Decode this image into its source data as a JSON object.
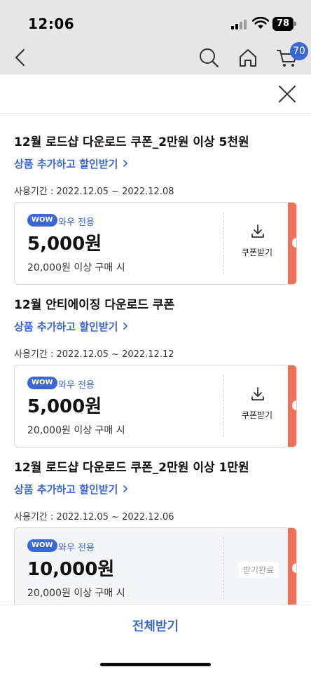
{
  "status_bar": {
    "time": "12:06",
    "battery": "78"
  },
  "nav": {
    "cart_badge": "70"
  },
  "coupons": [
    {
      "title": "12월 로드샵 다운로드 쿠폰_2만원 이상 5천원",
      "link": "상품 추가하고 할인받기",
      "period": "사용기간 : 2022.12.05 ~ 2022.12.08",
      "badge": "WOW",
      "badge_label": "와우 전용",
      "amount": "5,000원",
      "condition": "20,000원 이상 구매 시",
      "action": "쿠폰받기"
    },
    {
      "title": "12월 안티에이징 다운로드 쿠폰",
      "link": "상품 추가하고 할인받기",
      "period": "사용기간 : 2022.12.05 ~ 2022.12.12",
      "badge": "WOW",
      "badge_label": "와우 전용",
      "amount": "5,000원",
      "condition": "20,000원 이상 구매 시",
      "action": "쿠폰받기"
    },
    {
      "title": "12월 로드샵 다운로드 쿠폰_2만원 이상 1만원",
      "link": "상품 추가하고 할인받기",
      "period": "사용기간 : 2022.12.05 ~ 2022.12.06",
      "badge": "WOW",
      "badge_label": "와우 전용",
      "amount": "10,000원",
      "condition": "20,000원 이상 구매 시",
      "action": "받기완료"
    }
  ],
  "bottom": {
    "all_button": "전체받기"
  },
  "colors": {
    "accent": "#3b66d6",
    "coupon_stripe": "#ef6f58",
    "header_bg": "#e6e6e6"
  }
}
